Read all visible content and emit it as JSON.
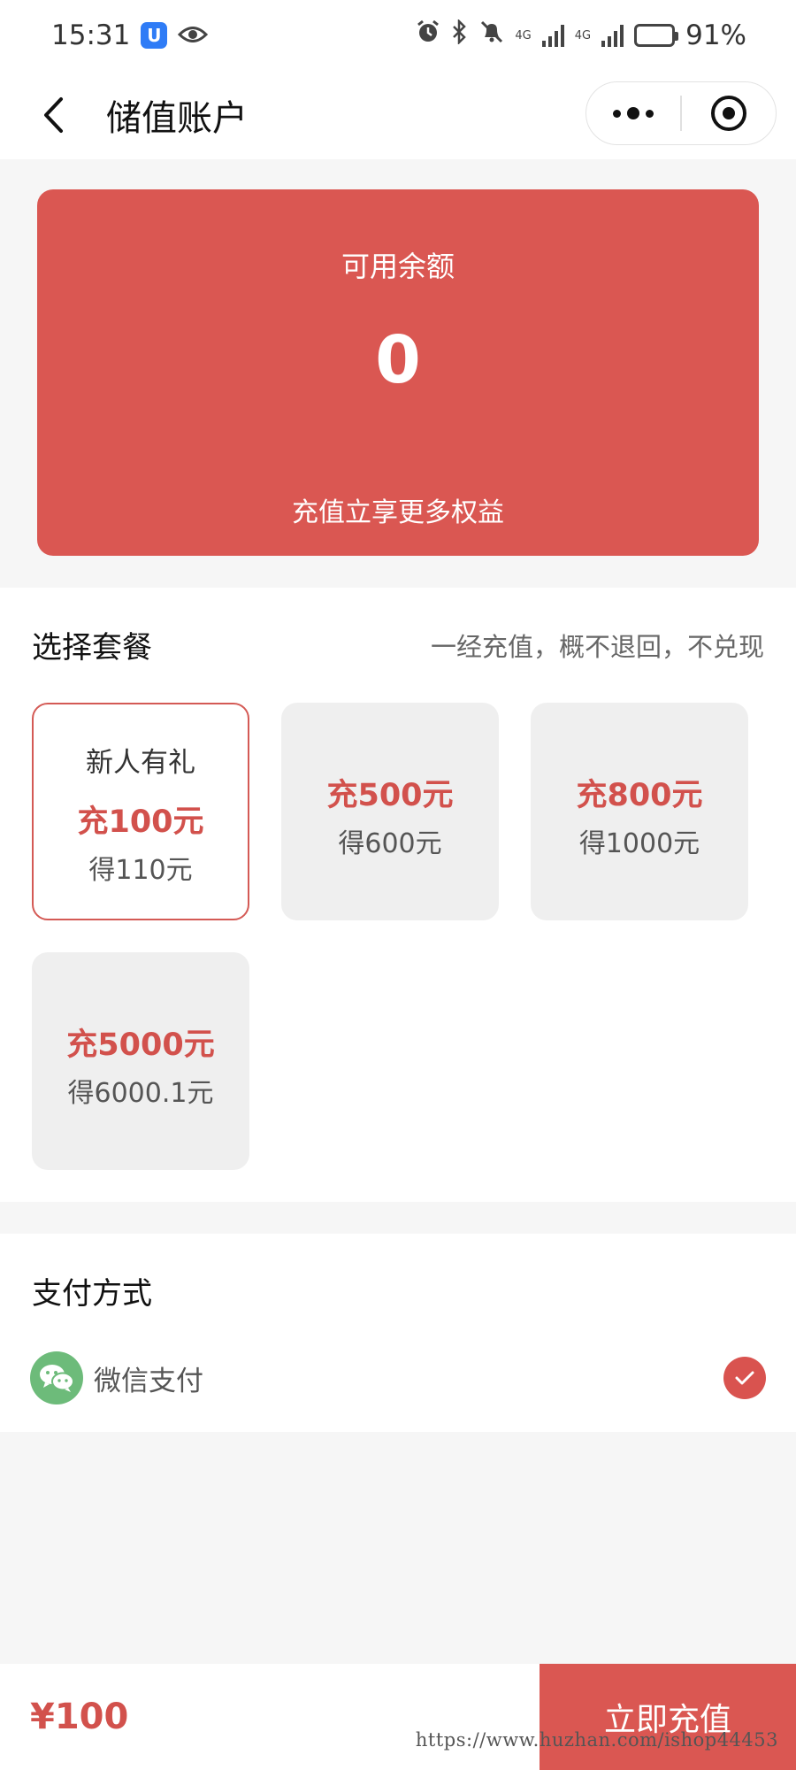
{
  "status_bar": {
    "time": "15:31",
    "network_1": "4G",
    "network_2": "4G",
    "battery_text": "91%",
    "battery_level": 0.91
  },
  "nav": {
    "title": "储值账户"
  },
  "balance": {
    "label": "可用余额",
    "value": "0",
    "tip": "充值立享更多权益"
  },
  "packages": {
    "title": "选择套餐",
    "note": "一经充值，概不退回，不兑现",
    "items": [
      {
        "tag": "新人有礼",
        "amount": "充100元",
        "get": "得110元",
        "selected": true
      },
      {
        "tag": "",
        "amount": "充500元",
        "get": "得600元",
        "selected": false
      },
      {
        "tag": "",
        "amount": "充800元",
        "get": "得1000元",
        "selected": false
      },
      {
        "tag": "",
        "amount": "充5000元",
        "get": "得6000.1元",
        "selected": false
      }
    ]
  },
  "payment": {
    "title": "支付方式",
    "method": "微信支付"
  },
  "footer": {
    "total": "¥100",
    "button_label": "立即充值"
  },
  "watermark": "https://www.huzhan.com/ishop44453",
  "colors": {
    "accent": "#da5752",
    "wechat": "#6dbb7a"
  }
}
